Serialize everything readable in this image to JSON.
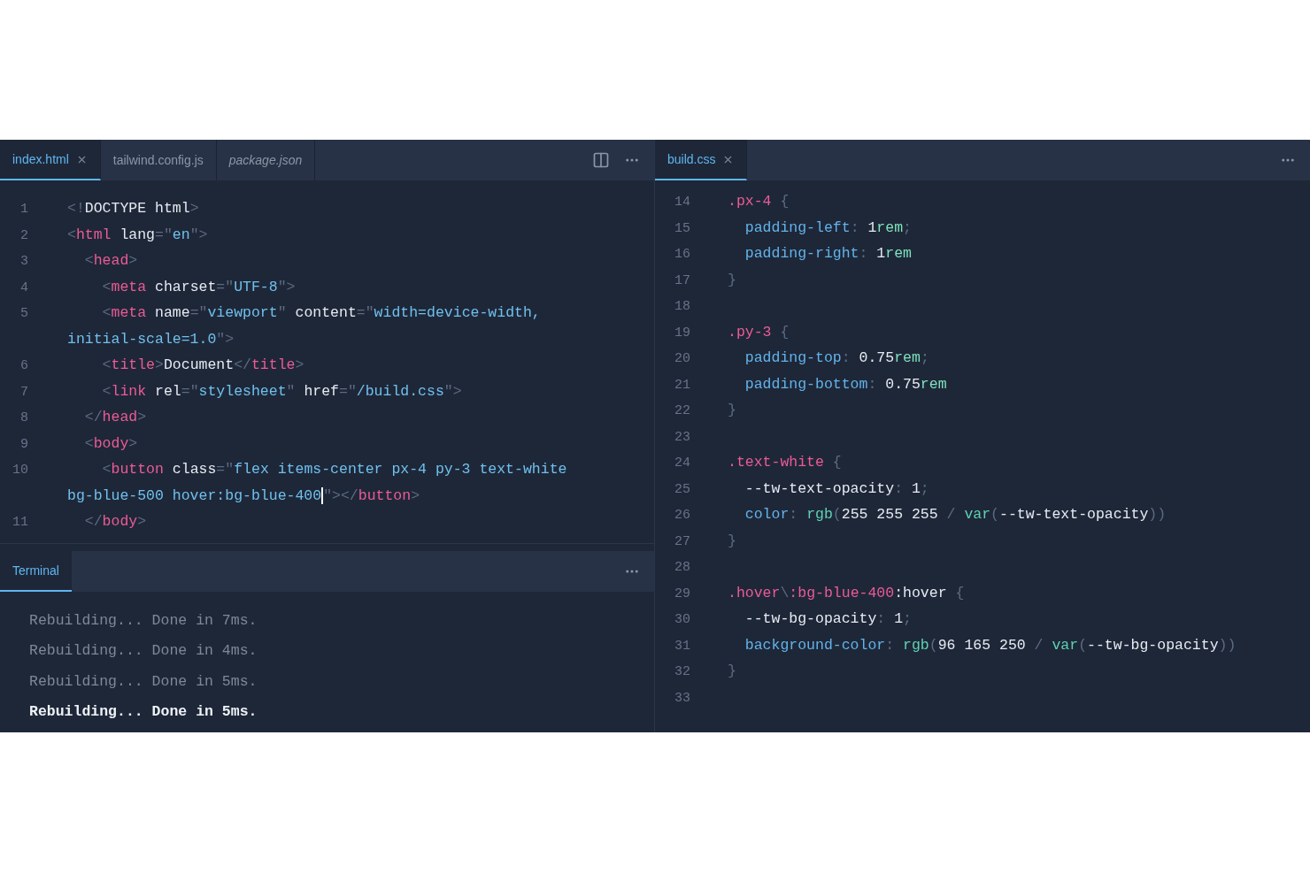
{
  "left_editor": {
    "tabs": [
      {
        "label": "index.html",
        "selected": true,
        "preview": false,
        "closable": true
      },
      {
        "label": "tailwind.config.js",
        "selected": false,
        "preview": false,
        "closable": false
      },
      {
        "label": "package.json",
        "selected": false,
        "preview": true,
        "closable": false
      }
    ],
    "lines": [
      {
        "number": "1",
        "tokens": [
          {
            "kind": "punct",
            "s": "<!"
          },
          {
            "kind": "text",
            "s": "DOCTYPE html"
          },
          {
            "kind": "punct",
            "s": ">"
          }
        ]
      },
      {
        "number": "2",
        "tokens": [
          {
            "kind": "punct",
            "s": "<"
          },
          {
            "kind": "tag",
            "s": "html"
          },
          {
            "kind": "text",
            "s": " lang"
          },
          {
            "kind": "punct",
            "s": "=\""
          },
          {
            "kind": "str",
            "s": "en"
          },
          {
            "kind": "punct",
            "s": "\">"
          }
        ]
      },
      {
        "number": "3",
        "tokens": [
          {
            "kind": "punct",
            "s": "  <"
          },
          {
            "kind": "tag",
            "s": "head"
          },
          {
            "kind": "punct",
            "s": ">"
          }
        ]
      },
      {
        "number": "4",
        "tokens": [
          {
            "kind": "punct",
            "s": "    <"
          },
          {
            "kind": "tag",
            "s": "meta"
          },
          {
            "kind": "text",
            "s": " charset"
          },
          {
            "kind": "punct",
            "s": "=\""
          },
          {
            "kind": "str",
            "s": "UTF-8"
          },
          {
            "kind": "punct",
            "s": "\">"
          }
        ]
      },
      {
        "number": "5",
        "tokens": [
          {
            "kind": "punct",
            "s": "    <"
          },
          {
            "kind": "tag",
            "s": "meta"
          },
          {
            "kind": "text",
            "s": " name"
          },
          {
            "kind": "punct",
            "s": "=\""
          },
          {
            "kind": "str",
            "s": "viewport"
          },
          {
            "kind": "punct",
            "s": "\""
          },
          {
            "kind": "text",
            "s": " content"
          },
          {
            "kind": "punct",
            "s": "=\""
          },
          {
            "kind": "str",
            "s": "width=device-width,"
          }
        ]
      },
      {
        "tokens": [
          {
            "kind": "str",
            "s": "initial-scale=1.0"
          },
          {
            "kind": "punct",
            "s": "\">"
          }
        ]
      },
      {
        "number": "6",
        "tokens": [
          {
            "kind": "punct",
            "s": "    <"
          },
          {
            "kind": "tag",
            "s": "title"
          },
          {
            "kind": "punct",
            "s": ">"
          },
          {
            "kind": "text",
            "s": "Document"
          },
          {
            "kind": "punct",
            "s": "</"
          },
          {
            "kind": "tag",
            "s": "title"
          },
          {
            "kind": "punct",
            "s": ">"
          }
        ]
      },
      {
        "number": "7",
        "tokens": [
          {
            "kind": "punct",
            "s": "    <"
          },
          {
            "kind": "tag",
            "s": "link"
          },
          {
            "kind": "text",
            "s": " rel"
          },
          {
            "kind": "punct",
            "s": "=\""
          },
          {
            "kind": "str",
            "s": "stylesheet"
          },
          {
            "kind": "punct",
            "s": "\""
          },
          {
            "kind": "text",
            "s": " href"
          },
          {
            "kind": "punct",
            "s": "=\""
          },
          {
            "kind": "str",
            "s": "/build.css"
          },
          {
            "kind": "punct",
            "s": "\">"
          }
        ]
      },
      {
        "number": "8",
        "tokens": [
          {
            "kind": "punct",
            "s": "  </"
          },
          {
            "kind": "tag",
            "s": "head"
          },
          {
            "kind": "punct",
            "s": ">"
          }
        ]
      },
      {
        "number": "9",
        "tokens": [
          {
            "kind": "punct",
            "s": "  <"
          },
          {
            "kind": "tag",
            "s": "body"
          },
          {
            "kind": "punct",
            "s": ">"
          }
        ]
      },
      {
        "number": "10",
        "tokens": [
          {
            "kind": "punct",
            "s": "    <"
          },
          {
            "kind": "tag",
            "s": "button"
          },
          {
            "kind": "text",
            "s": " class"
          },
          {
            "kind": "punct",
            "s": "=\""
          },
          {
            "kind": "str",
            "s": "flex items-center px-4 py-3 text-white"
          }
        ]
      },
      {
        "tokens": [
          {
            "kind": "str",
            "s": "bg-blue-500 hover:bg-blue-400"
          },
          {
            "kind": "cursor"
          },
          {
            "kind": "punct",
            "s": "\"></"
          },
          {
            "kind": "tag",
            "s": "button"
          },
          {
            "kind": "punct",
            "s": ">"
          }
        ]
      },
      {
        "number": "11",
        "tokens": [
          {
            "kind": "punct",
            "s": "  </"
          },
          {
            "kind": "tag",
            "s": "body"
          },
          {
            "kind": "punct",
            "s": ">"
          }
        ]
      }
    ]
  },
  "terminal": {
    "tab": {
      "label": "Terminal",
      "selected": true
    },
    "lines": [
      {
        "text": "Rebuilding... Done in 7ms.",
        "current": false
      },
      {
        "text": "Rebuilding... Done in 4ms.",
        "current": false
      },
      {
        "text": "Rebuilding... Done in 5ms.",
        "current": false
      },
      {
        "text": "Rebuilding... Done in 5ms.",
        "current": true
      }
    ]
  },
  "right_editor": {
    "tabs": [
      {
        "label": "build.css",
        "selected": true,
        "preview": false,
        "closable": true
      }
    ],
    "lines": [
      {
        "number": "14",
        "tokens": [
          {
            "kind": "sel",
            "s": ".px-4"
          },
          {
            "kind": "punct",
            "s": " {"
          }
        ]
      },
      {
        "number": "15",
        "tokens": [
          {
            "kind": "prop",
            "s": "  padding-left"
          },
          {
            "kind": "punct",
            "s": ": "
          },
          {
            "kind": "text",
            "s": "1"
          },
          {
            "kind": "unit",
            "s": "rem"
          },
          {
            "kind": "punct",
            "s": ";"
          }
        ]
      },
      {
        "number": "16",
        "tokens": [
          {
            "kind": "prop",
            "s": "  padding-right"
          },
          {
            "kind": "punct",
            "s": ": "
          },
          {
            "kind": "text",
            "s": "1"
          },
          {
            "kind": "unit",
            "s": "rem"
          }
        ]
      },
      {
        "number": "17",
        "tokens": [
          {
            "kind": "punct",
            "s": "}"
          }
        ]
      },
      {
        "number": "18"
      },
      {
        "number": "19",
        "tokens": [
          {
            "kind": "sel",
            "s": ".py-3"
          },
          {
            "kind": "punct",
            "s": " {"
          }
        ]
      },
      {
        "number": "20",
        "tokens": [
          {
            "kind": "prop",
            "s": "  padding-top"
          },
          {
            "kind": "punct",
            "s": ": "
          },
          {
            "kind": "text",
            "s": "0.75"
          },
          {
            "kind": "unit",
            "s": "rem"
          },
          {
            "kind": "punct",
            "s": ";"
          }
        ]
      },
      {
        "number": "21",
        "tokens": [
          {
            "kind": "prop",
            "s": "  padding-bottom"
          },
          {
            "kind": "punct",
            "s": ": "
          },
          {
            "kind": "text",
            "s": "0.75"
          },
          {
            "kind": "unit",
            "s": "rem"
          }
        ]
      },
      {
        "number": "22",
        "tokens": [
          {
            "kind": "punct",
            "s": "}"
          }
        ]
      },
      {
        "number": "23"
      },
      {
        "number": "24",
        "tokens": [
          {
            "kind": "sel",
            "s": ".text-white"
          },
          {
            "kind": "punct",
            "s": " {"
          }
        ]
      },
      {
        "number": "25",
        "tokens": [
          {
            "kind": "text",
            "s": "  --tw-text-opacity"
          },
          {
            "kind": "punct",
            "s": ": "
          },
          {
            "kind": "text",
            "s": "1"
          },
          {
            "kind": "punct",
            "s": ";"
          }
        ]
      },
      {
        "number": "26",
        "tokens": [
          {
            "kind": "prop",
            "s": "  color"
          },
          {
            "kind": "punct",
            "s": ": "
          },
          {
            "kind": "fn",
            "s": "rgb"
          },
          {
            "kind": "punct",
            "s": "("
          },
          {
            "kind": "text",
            "s": "255 255 255 "
          },
          {
            "kind": "punct",
            "s": "/ "
          },
          {
            "kind": "fn",
            "s": "var"
          },
          {
            "kind": "punct",
            "s": "("
          },
          {
            "kind": "text",
            "s": "--tw-text-opacity"
          },
          {
            "kind": "punct",
            "s": "))"
          }
        ]
      },
      {
        "number": "27",
        "tokens": [
          {
            "kind": "punct",
            "s": "}"
          }
        ]
      },
      {
        "number": "28"
      },
      {
        "number": "29",
        "tokens": [
          {
            "kind": "sel",
            "s": ".hover"
          },
          {
            "kind": "punct",
            "s": "\\"
          },
          {
            "kind": "sel",
            "s": ":bg-blue-400"
          },
          {
            "kind": "text",
            "s": ":hover"
          },
          {
            "kind": "punct",
            "s": " {"
          }
        ]
      },
      {
        "number": "30",
        "tokens": [
          {
            "kind": "text",
            "s": "  --tw-bg-opacity"
          },
          {
            "kind": "punct",
            "s": ": "
          },
          {
            "kind": "text",
            "s": "1"
          },
          {
            "kind": "punct",
            "s": ";"
          }
        ]
      },
      {
        "number": "31",
        "tokens": [
          {
            "kind": "prop",
            "s": "  background-color"
          },
          {
            "kind": "punct",
            "s": ": "
          },
          {
            "kind": "fn",
            "s": "rgb"
          },
          {
            "kind": "punct",
            "s": "("
          },
          {
            "kind": "text",
            "s": "96 165 250 "
          },
          {
            "kind": "punct",
            "s": "/ "
          },
          {
            "kind": "fn",
            "s": "var"
          },
          {
            "kind": "punct",
            "s": "("
          },
          {
            "kind": "text",
            "s": "--tw-bg-opacity"
          },
          {
            "kind": "punct",
            "s": "))"
          }
        ]
      },
      {
        "number": "32",
        "tokens": [
          {
            "kind": "punct",
            "s": "}"
          }
        ]
      },
      {
        "number": "33"
      }
    ]
  }
}
